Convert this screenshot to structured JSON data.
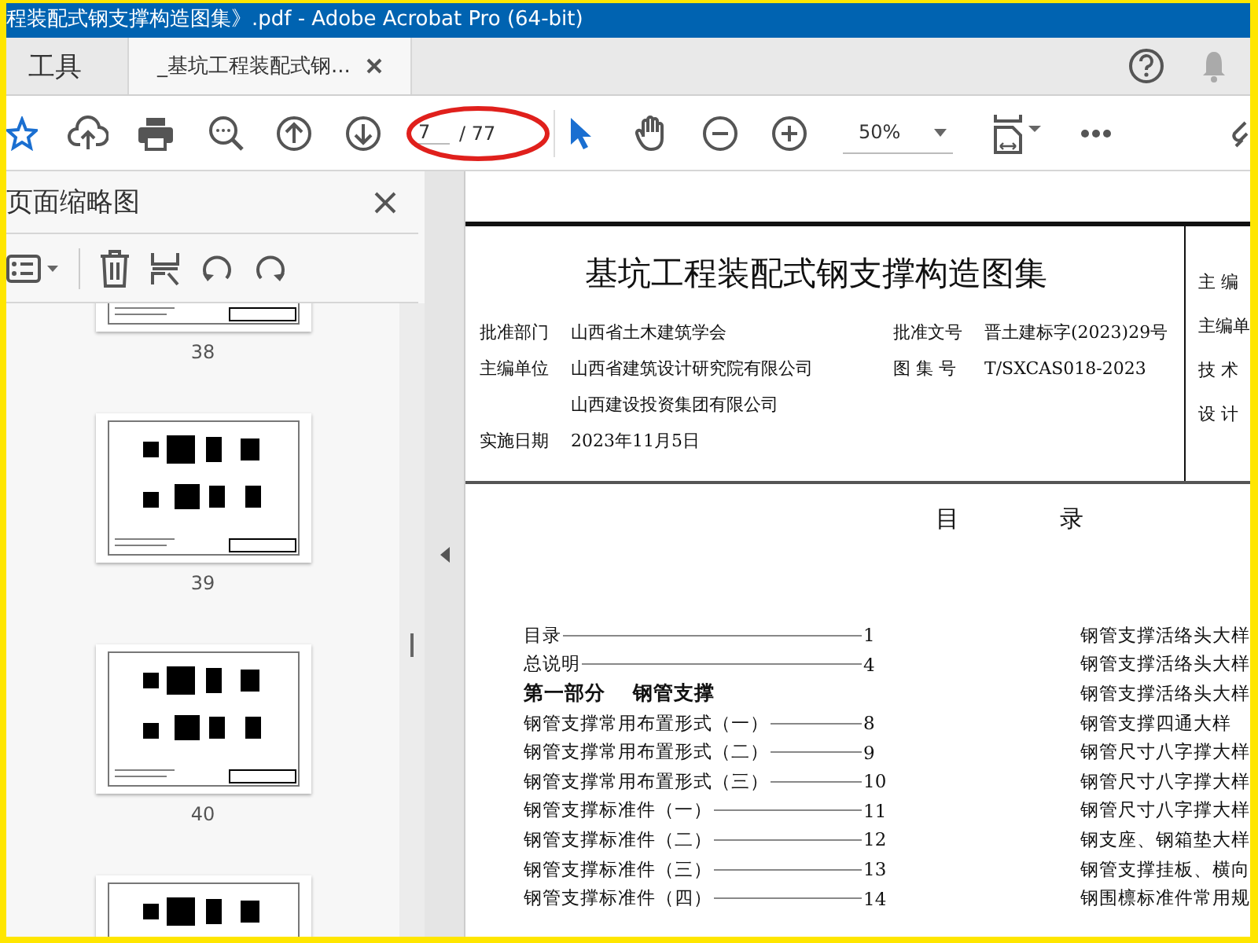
{
  "window": {
    "title": "程装配式钢支撑构造图集》.pdf - Adobe Acrobat Pro (64-bit)"
  },
  "tabs": [
    {
      "label": "工具",
      "selected": false
    },
    {
      "label": "_基坑工程装配式钢...",
      "selected": true
    }
  ],
  "toolbar": {
    "page_field": {
      "value": "7",
      "total": "/ 77",
      "circled": true
    },
    "zoom": {
      "value": "50%"
    }
  },
  "sidebar": {
    "title": "页面缩略图",
    "thumbnails": [
      {
        "page": "38"
      },
      {
        "page": "39"
      },
      {
        "page": "40"
      }
    ],
    "partial_thumbnail": true
  },
  "document": {
    "title": "基坑工程装配式钢支撑构造图集",
    "info_rows": [
      {
        "label": "批准部门",
        "value": "山西省土木建筑学会",
        "label_2": "批准文号",
        "value_2": "晋土建标字(2023)29号"
      },
      {
        "label": "主编单位",
        "value": "山西省建筑设计研究院有限公司",
        "label_2": "图 集 号",
        "value_2": "T/SXCAS018-2023"
      },
      {
        "value": "山西建设投资集团有限公司"
      },
      {
        "label": "实施日期",
        "value": "2023年11月5日"
      }
    ],
    "side_labels": [
      "主 编",
      "主编单",
      "技 术",
      "设 计"
    ],
    "toc_heading": [
      "目",
      "录"
    ],
    "toc_left": [
      {
        "kind": "entry",
        "text": "目录",
        "page": "1"
      },
      {
        "kind": "entry",
        "text": "总说明",
        "page": "4"
      },
      {
        "kind": "section",
        "text": "第一部分    钢管支撑"
      },
      {
        "kind": "entry",
        "text": "钢管支撑常用布置形式（一）",
        "page": "8"
      },
      {
        "kind": "entry",
        "text": "钢管支撑常用布置形式（二）",
        "page": "9"
      },
      {
        "kind": "entry",
        "text": "钢管支撑常用布置形式（三）",
        "page": "10"
      },
      {
        "kind": "entry",
        "text": "钢管支撑标准件（一）",
        "page": "11"
      },
      {
        "kind": "entry",
        "text": "钢管支撑标准件（二）",
        "page": "12"
      },
      {
        "kind": "entry",
        "text": "钢管支撑标准件（三）",
        "page": "13"
      },
      {
        "kind": "entry",
        "text": "钢管支撑标准件（四）",
        "page": "14"
      }
    ],
    "toc_right": [
      "钢管支撑活络头大样",
      "钢管支撑活络头大样",
      "钢管支撑活络头大样",
      "钢管支撑四通大样",
      "钢管尺寸八字撑大样",
      "钢管尺寸八字撑大样",
      "钢管尺寸八字撑大样",
      "钢支座、钢箱垫大样",
      "钢管支撑挂板、横向",
      "钢围檩标准件常用规"
    ]
  }
}
